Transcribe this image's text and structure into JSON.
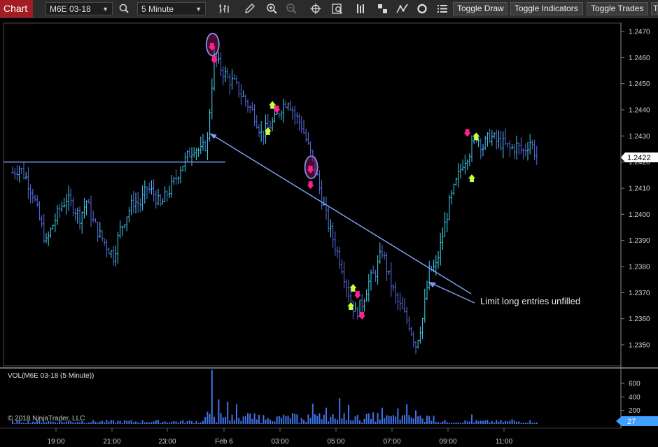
{
  "toolbar": {
    "chart_tab": "Chart",
    "instrument": "M6E 03-18",
    "interval": "5 Minute",
    "icons": [
      "bar-type-icon",
      "pencil-icon",
      "zoom-in-icon",
      "zoom-out-icon",
      "crosshair-icon",
      "data-box-icon",
      "strategy-icon",
      "drawing-objects-icon",
      "indicators-icon",
      "reload-icon",
      "properties-icon"
    ],
    "toggle_draw": "Toggle Draw",
    "toggle_indicators": "Toggle Indicators",
    "toggle_trades": "Toggle Trades",
    "overflow": "T"
  },
  "colors": {
    "accent": "#a51d24",
    "bar_up": "#40d4f0",
    "bar_down": "#5a6ee8",
    "trendline": "#7a9cf0",
    "volume": "#3f72e8",
    "current_price_badge": "#3fa0ff",
    "sell_marker": "#ff1f8f",
    "buy_marker": "#c6ff40"
  },
  "chart_data": [
    {
      "type": "candlestick",
      "instrument": "M6E 03-18",
      "interval": "5 Minute",
      "y_ticks": [
        "1.2470",
        "1.2460",
        "1.2450",
        "1.2440",
        "1.2430",
        "1.2420",
        "1.2410",
        "1.2400",
        "1.2390",
        "1.2380",
        "1.2370",
        "1.2360",
        "1.2350"
      ],
      "ylim": [
        1.2341,
        1.2475
      ],
      "current_price": "1.2422",
      "x_ticks": [
        "19:00",
        "21:00",
        "23:00",
        "Feb 6",
        "03:00",
        "05:00",
        "07:00",
        "09:00",
        "11:00"
      ],
      "close_path": [
        [
          0,
          1.2416
        ],
        [
          3,
          1.2418
        ],
        [
          6,
          1.2414
        ],
        [
          9,
          1.2408
        ],
        [
          12,
          1.2398
        ],
        [
          15,
          1.2389
        ],
        [
          18,
          1.2396
        ],
        [
          21,
          1.2402
        ],
        [
          24,
          1.2406
        ],
        [
          27,
          1.2403
        ],
        [
          30,
          1.2399
        ],
        [
          33,
          1.2405
        ],
        [
          36,
          1.2397
        ],
        [
          39,
          1.2392
        ],
        [
          42,
          1.2388
        ],
        [
          45,
          1.2384
        ],
        [
          48,
          1.2394
        ],
        [
          51,
          1.24
        ],
        [
          54,
          1.2405
        ],
        [
          57,
          1.2404
        ],
        [
          60,
          1.241
        ],
        [
          63,
          1.2408
        ],
        [
          66,
          1.2403
        ],
        [
          69,
          1.2408
        ],
        [
          72,
          1.2412
        ],
        [
          75,
          1.2418
        ],
        [
          78,
          1.2422
        ],
        [
          81,
          1.2426
        ],
        [
          84,
          1.2424
        ],
        [
          87,
          1.2428
        ],
        [
          88,
          1.244
        ],
        [
          90,
          1.246
        ],
        [
          93,
          1.2456
        ],
        [
          96,
          1.2452
        ],
        [
          99,
          1.245
        ],
        [
          102,
          1.2446
        ],
        [
          105,
          1.2442
        ],
        [
          108,
          1.2438
        ],
        [
          111,
          1.2431
        ],
        [
          114,
          1.2433
        ],
        [
          117,
          1.2436
        ],
        [
          120,
          1.2441
        ],
        [
          123,
          1.2444
        ],
        [
          126,
          1.2438
        ],
        [
          129,
          1.2434
        ],
        [
          132,
          1.2426
        ],
        [
          135,
          1.2418
        ],
        [
          138,
          1.2406
        ],
        [
          141,
          1.2396
        ],
        [
          144,
          1.2388
        ],
        [
          147,
          1.238
        ],
        [
          150,
          1.237
        ],
        [
          153,
          1.2362
        ],
        [
          156,
          1.2366
        ],
        [
          159,
          1.2374
        ],
        [
          162,
          1.2378
        ],
        [
          165,
          1.2386
        ],
        [
          168,
          1.2376
        ],
        [
          171,
          1.2368
        ],
        [
          174,
          1.2363
        ],
        [
          177,
          1.2358
        ],
        [
          180,
          1.235
        ],
        [
          183,
          1.236
        ],
        [
          186,
          1.2378
        ],
        [
          189,
          1.238
        ],
        [
          192,
          1.2392
        ],
        [
          195,
          1.2404
        ],
        [
          198,
          1.2412
        ],
        [
          201,
          1.242
        ],
        [
          204,
          1.2424
        ],
        [
          207,
          1.243
        ],
        [
          210,
          1.2426
        ],
        [
          213,
          1.243
        ],
        [
          216,
          1.2428
        ],
        [
          219,
          1.2427
        ],
        [
          222,
          1.2425
        ],
        [
          225,
          1.2426
        ],
        [
          228,
          1.2424
        ],
        [
          231,
          1.2428
        ],
        [
          234,
          1.2422
        ]
      ],
      "trend_line": {
        "start": [
          88,
          1.2431
        ],
        "end": [
          200,
          1.2372
        ]
      },
      "horizontal_line": {
        "price": 1.242,
        "start_bar": 0,
        "end_bar": 95
      },
      "annotation": "Limit long entries unfilled",
      "circled_sell_bars": [
        {
          "bar": 89,
          "price": 1.2465
        },
        {
          "bar": 133,
          "price": 1.2418
        }
      ],
      "sell_arrows": [
        [
          89,
          1.2464
        ],
        [
          90,
          1.2459
        ],
        [
          118,
          1.244
        ],
        [
          154,
          1.2369
        ],
        [
          156,
          1.2361
        ],
        [
          133,
          1.2417
        ],
        [
          133,
          1.2411
        ],
        [
          203,
          1.2431
        ]
      ],
      "buy_arrows": [
        [
          114,
          1.2432
        ],
        [
          116,
          1.2442
        ],
        [
          151,
          1.2365
        ],
        [
          152,
          1.2372
        ],
        [
          205,
          1.2414
        ],
        [
          207,
          1.243
        ]
      ]
    },
    {
      "type": "bar",
      "title": "VOL(M6E 03-18 (5 Minute))",
      "y_ticks": [
        "600",
        "400",
        "200"
      ],
      "ylim": [
        0,
        900
      ],
      "current_value": "27",
      "peak_values": [
        [
          89,
          800
        ],
        [
          92,
          360
        ],
        [
          96,
          330
        ],
        [
          100,
          290
        ],
        [
          87,
          180
        ],
        [
          134,
          300
        ],
        [
          140,
          240
        ],
        [
          146,
          380
        ],
        [
          150,
          280
        ],
        [
          165,
          240
        ],
        [
          176,
          290
        ],
        [
          172,
          230
        ],
        [
          180,
          200
        ],
        [
          205,
          140
        ],
        [
          223,
          70
        ]
      ]
    }
  ],
  "copyright": "© 2018 NinjaTrader, LLC"
}
